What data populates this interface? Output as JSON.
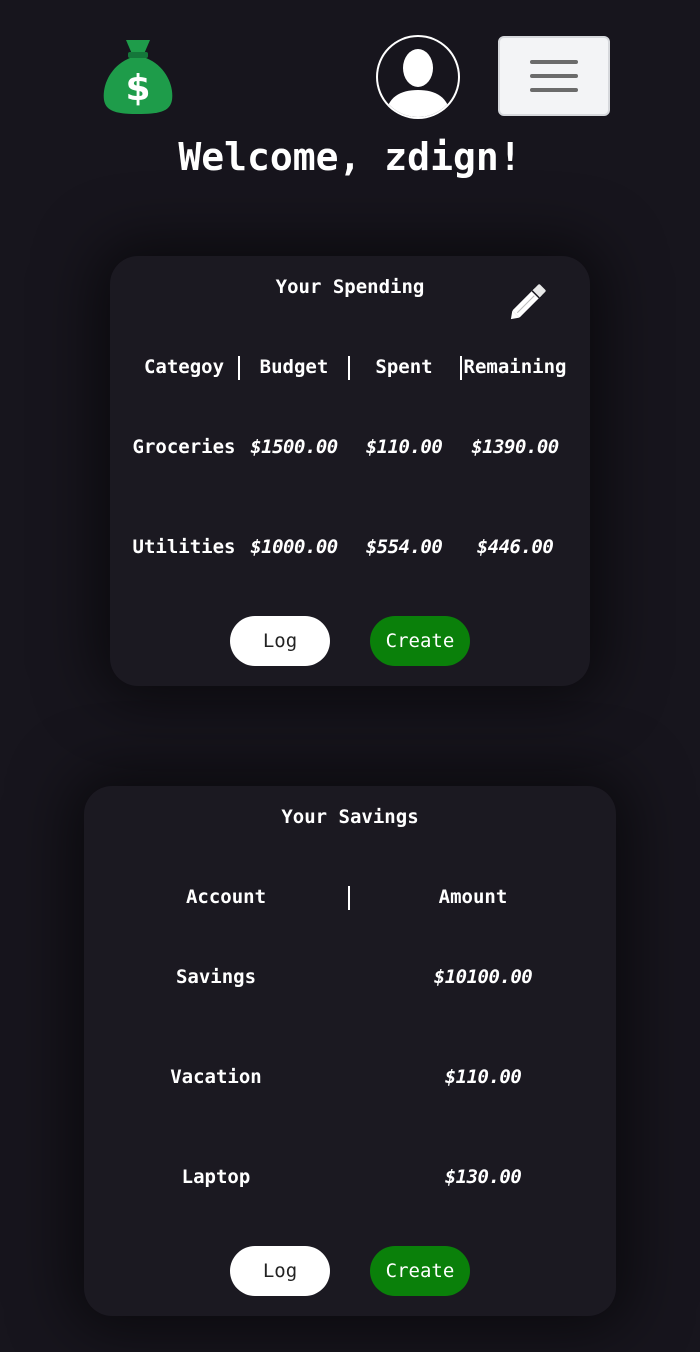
{
  "header": {
    "logo_icon": "money-bag-icon",
    "avatar_icon": "user-avatar-icon",
    "menu_icon": "hamburger-menu-icon",
    "welcome": "Welcome, zdign!"
  },
  "spending": {
    "title": "Your Spending",
    "edit_icon": "pencil-icon",
    "columns": [
      "Categoy",
      "Budget",
      "Spent",
      "Remaining"
    ],
    "rows": [
      [
        "Groceries",
        "$1500.00",
        "$110.00",
        "$1390.00"
      ],
      [
        "Utilities",
        "$1000.00",
        "$554.00",
        "$446.00"
      ]
    ],
    "log_label": "Log",
    "create_label": "Create"
  },
  "savings": {
    "title": "Your Savings",
    "columns": [
      "Account",
      "Amount"
    ],
    "rows": [
      [
        "Savings",
        "$10100.00"
      ],
      [
        "Vacation",
        "$110.00"
      ],
      [
        "Laptop",
        "$130.00"
      ]
    ],
    "log_label": "Log",
    "create_label": "Create"
  },
  "colors": {
    "background": "#17151d",
    "card": "#1b1921",
    "create_button": "#0a800a",
    "logo_green": "#1e9c4a"
  }
}
